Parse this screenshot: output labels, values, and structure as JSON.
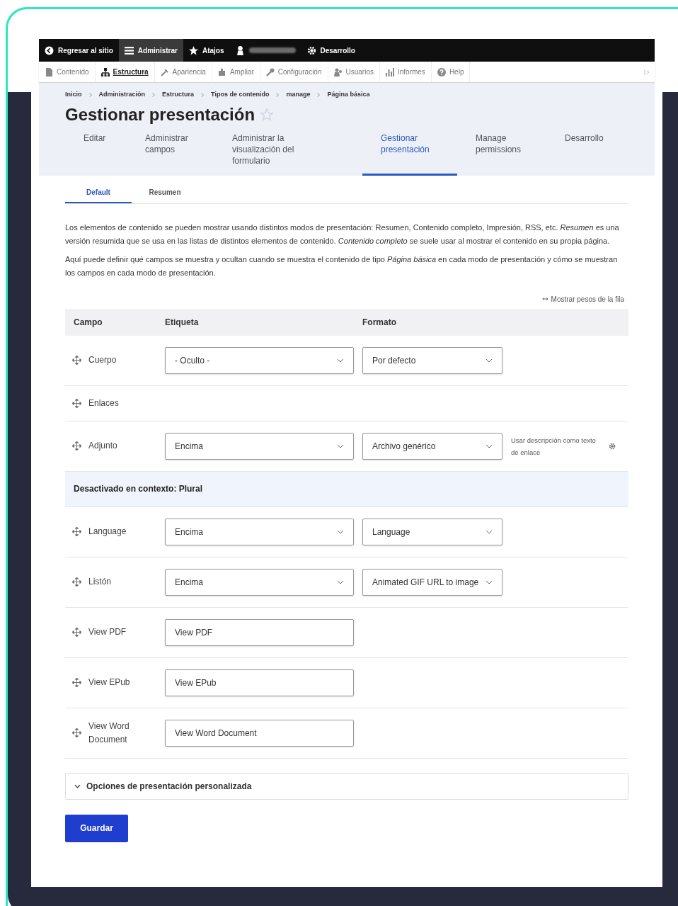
{
  "admin_toolbar": [
    {
      "kind": "item",
      "label": "Regresar al sitio",
      "selected": false
    },
    {
      "kind": "item",
      "label": "Administrar",
      "selected": true
    },
    {
      "kind": "item",
      "label": "Atajos",
      "selected": false
    },
    {
      "kind": "redacted",
      "selected": false
    },
    {
      "kind": "item",
      "label": "Desarrollo",
      "selected": false
    }
  ],
  "menu_bar": [
    {
      "label": "Contenido",
      "selected": false
    },
    {
      "label": "Estructura",
      "selected": true
    },
    {
      "label": "Apariencia",
      "selected": false
    },
    {
      "label": "Ampliar",
      "selected": false
    },
    {
      "label": "Configuración",
      "selected": false
    },
    {
      "label": "Usuarios",
      "selected": false
    },
    {
      "label": "Informes",
      "selected": false
    },
    {
      "label": "Help",
      "selected": false
    }
  ],
  "breadcrumb": [
    "Inicio",
    "Administración",
    "Estructura",
    "Tipos de contenido",
    "manage",
    "Página básica"
  ],
  "page_title": "Gestionar presentación",
  "favorite": false,
  "tabs": [
    {
      "label": "Editar",
      "selected": false
    },
    {
      "label": "Administrar campos",
      "selected": false
    },
    {
      "label": "Administrar la visualización del formulario",
      "selected": false
    },
    {
      "label": "Gestionar presentación",
      "selected": true
    },
    {
      "label": "Manage permissions",
      "selected": false
    },
    {
      "label": "Desarrollo",
      "selected": false
    }
  ],
  "subtabs": [
    {
      "label": "Default",
      "selected": true
    },
    {
      "label": "Resumen",
      "selected": false
    }
  ],
  "description": [
    "Los elementos de contenido se pueden mostrar usando distintos modos de presentación: Resumen, Contenido completo, Impresión, RSS, etc. *Resumen* es una versión resumida que se usa en las listas de distintos elementos de contenido. *Contenido completo* se suele usar al mostrar el contenido en su propia página.",
    "Aquí puede definir qué campos se muestra y ocultan cuando se muestra el contenido de tipo *Página básica* en cada modo de presentación y cómo se muestran los campos en cada modo de presentación."
  ],
  "weights_link": "Mostrar pesos de la fila",
  "table": {
    "columns": [
      "Campo",
      "Etiqueta",
      "Formato"
    ],
    "rows": [
      {
        "kind": "field",
        "field": "Cuerpo",
        "label": "- Oculto -",
        "format": "Por defecto"
      },
      {
        "kind": "field",
        "field": "Enlaces"
      },
      {
        "kind": "field",
        "field": "Adjunto",
        "label": "Encima",
        "format": "Archivo genérico",
        "summary": "Usar descripción como texto de enlace"
      },
      {
        "kind": "region",
        "field": "Desactivado en contexto: Plural"
      },
      {
        "kind": "field",
        "field": "Language",
        "label": "Encima",
        "format": "Language"
      },
      {
        "kind": "field",
        "field": "Listón",
        "label": "Encima",
        "format": "Animated GIF URL to image"
      },
      {
        "kind": "text",
        "field": "View PDF",
        "value": "View PDF"
      },
      {
        "kind": "text",
        "field": "View EPub",
        "value": "View EPub"
      },
      {
        "kind": "text",
        "field": "View Word Document",
        "value": "View Word Document"
      }
    ]
  },
  "details": {
    "label": "Opciones de presentación personalizada",
    "expanded": false
  },
  "save_button": "Guardar"
}
